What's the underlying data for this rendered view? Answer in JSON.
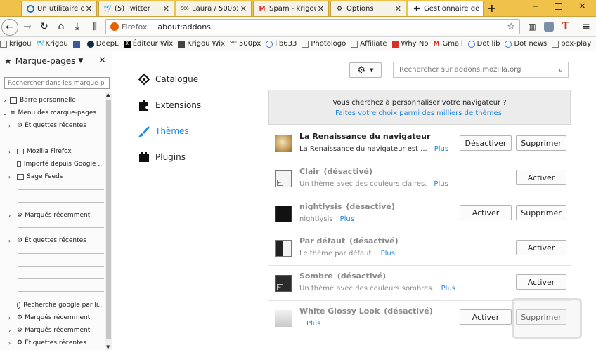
{
  "tabs": [
    {
      "label": "Un utilitaire con",
      "icon": "edge-icon"
    },
    {
      "label": "(5) Twitter",
      "icon": "twitter-icon"
    },
    {
      "label": "Laura / 500px",
      "icon": "500px-icon"
    },
    {
      "label": "Spam - krigou",
      "icon": "gmail-icon"
    },
    {
      "label": "Options",
      "icon": "gear-icon"
    },
    {
      "label": "Gestionnaire de",
      "icon": "puzzle-icon"
    }
  ],
  "nav": {
    "identity_label": "Firefox",
    "url": "about:addons"
  },
  "bookmarks": [
    {
      "label": "krigou",
      "icon": "folder-icon"
    },
    {
      "label": "Krigou",
      "icon": "twitter-icon"
    },
    {
      "label": "",
      "icon": "facebook-icon"
    },
    {
      "label": "DeepL",
      "icon": "deepl-icon"
    },
    {
      "label": "Éditeur Wix",
      "icon": "wix-icon"
    },
    {
      "label": "Krigou Wix",
      "icon": "wix-icon"
    },
    {
      "label": "500px",
      "icon": "500px-icon"
    },
    {
      "label": "lib633",
      "icon": "globe-icon"
    },
    {
      "label": "Photologo",
      "icon": "page-icon"
    },
    {
      "label": "Affiliate",
      "icon": "folder-icon"
    },
    {
      "label": "Why No",
      "icon": "bookmark-icon"
    },
    {
      "label": "Gmail",
      "icon": "gmail-icon"
    },
    {
      "label": "Dot lib",
      "icon": "globe-icon"
    },
    {
      "label": "Dot news",
      "icon": "globe-icon"
    },
    {
      "label": "box-play",
      "icon": "folder-icon"
    }
  ],
  "sidebar": {
    "title": "Marque-pages",
    "search_placeholder": "Rechercher dans les marque-p",
    "items": [
      {
        "label": "Barre personnelle",
        "icon": "toolbar-icon"
      },
      {
        "label": "Menu des marque-pages",
        "icon": "menu-icon"
      },
      {
        "label": "Étiquettes récentes",
        "icon": "gear-icon"
      },
      {
        "label": "Mozilla Firefox",
        "icon": "folder-icon"
      },
      {
        "label": "Importé depuis Google ...",
        "icon": "folder-icon"
      },
      {
        "label": "Sage Feeds",
        "icon": "folder-icon"
      },
      {
        "label": "Marqués récemment",
        "icon": "gear-icon"
      },
      {
        "label": "Étiquettes récentes",
        "icon": "gear-icon"
      },
      {
        "label": "Recherche google par li...",
        "icon": "globe-icon"
      },
      {
        "label": "Marqués récemment",
        "icon": "gear-icon"
      },
      {
        "label": "Marqués récemment",
        "icon": "gear-icon"
      },
      {
        "label": "Étiquettes récentes",
        "icon": "gear-icon"
      }
    ]
  },
  "categories": [
    {
      "label": "Catalogue",
      "icon": "catalogue-icon"
    },
    {
      "label": "Extensions",
      "icon": "puzzle-icon"
    },
    {
      "label": "Thèmes",
      "icon": "brush-icon"
    },
    {
      "label": "Plugins",
      "icon": "plugin-icon"
    }
  ],
  "search": {
    "placeholder": "Rechercher sur addons.mozilla.org"
  },
  "banner": {
    "line1": "Vous cherchez à personnaliser votre navigateur ?",
    "link": "Faites votre choix parmi des milliers de thèmes."
  },
  "addons": [
    {
      "name": "La Renaissance du navigateur",
      "status": "",
      "desc": "La Renaissance du navigateur est ...",
      "more": "Plus",
      "buttons": [
        "Désactiver",
        "Supprimer"
      ]
    },
    {
      "name": "Clair",
      "status": "(désactivé)",
      "desc": "Un thème avec des couleurs claires.",
      "more": "Plus",
      "buttons": [
        "Activer"
      ]
    },
    {
      "name": "nightlysis",
      "status": "(désactivé)",
      "desc": "nightlysis",
      "more": "Plus",
      "buttons": [
        "Activer",
        "Supprimer"
      ]
    },
    {
      "name": "Par défaut",
      "status": "(désactivé)",
      "desc": "Le thème par défaut.",
      "more": "Plus",
      "buttons": [
        "Activer"
      ]
    },
    {
      "name": "Sombre",
      "status": "(désactivé)",
      "desc": "Un thème avec des couleurs sombres.",
      "more": "Plus",
      "buttons": [
        "Activer"
      ]
    },
    {
      "name": "White Glossy Look",
      "status": "(désactivé)",
      "desc": "",
      "more": "Plus",
      "buttons": [
        "Activer",
        "Supprimer"
      ]
    }
  ],
  "colors": {
    "tabbar": "#f1c24a",
    "link": "#1e88e5",
    "banner_bg": "#ececec"
  }
}
